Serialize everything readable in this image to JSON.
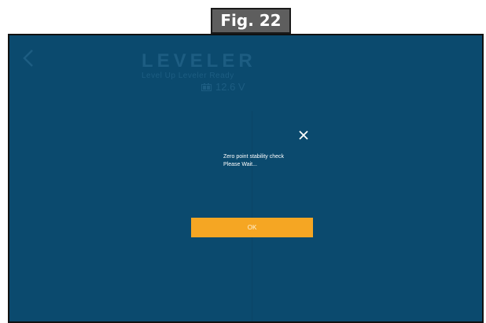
{
  "figure_label": "Fig. 22",
  "app": {
    "title": "LEVELER",
    "subtitle": "Level Up Leveler Ready",
    "battery_voltage": "12.6 V"
  },
  "dialog": {
    "message_line1": "Zero point stability check",
    "message_line2": "Please Wait...",
    "ok_label": "OK"
  },
  "icons": {
    "back": "chevron-left-icon",
    "battery": "battery-icon",
    "close": "close-icon"
  },
  "colors": {
    "screen_background": "#0b4a6e",
    "header_text": "#1d5d82",
    "button_accent": "#f5a623",
    "dialog_text": "#ffffff",
    "figure_tag_background": "#5e5e5e"
  }
}
